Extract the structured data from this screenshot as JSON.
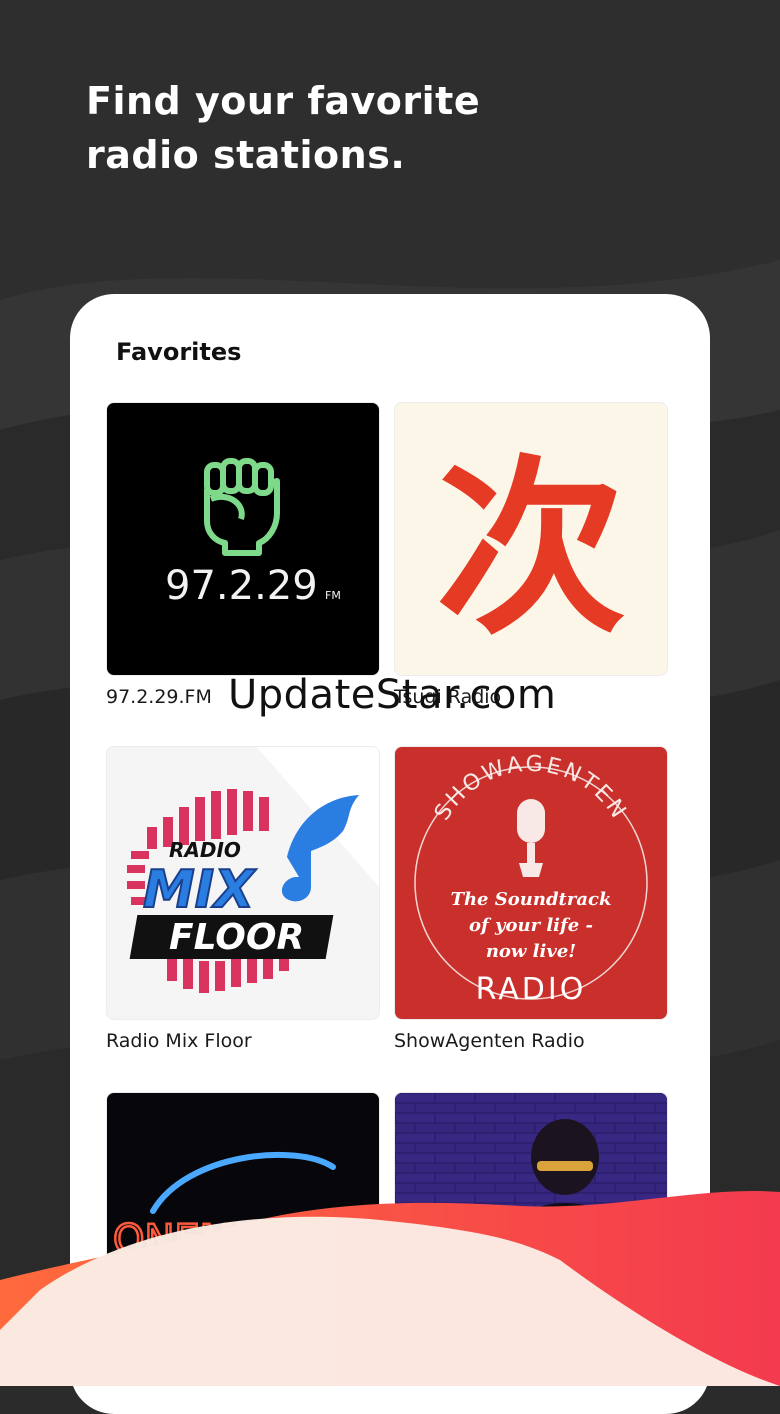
{
  "headline": {
    "line1": "Find your favorite",
    "line2": "radio stations."
  },
  "favorites": {
    "title": "Favorites",
    "stations": [
      {
        "name": "97.2.29.FM",
        "logo_text": "97.2.29",
        "logo_suffix": "FM",
        "logo_icon": "raised-fist-icon"
      },
      {
        "name": "Tsugi Radio",
        "logo_text": "次"
      },
      {
        "name": "Radio Mix Floor",
        "logo_top": "RADIO",
        "logo_mid": "MIX",
        "logo_bottom": "FLOOR"
      },
      {
        "name": "ShowAgenten Radio",
        "logo_arc": "SHOWAGENTEN",
        "logo_tagline_1": "The Soundtrack",
        "logo_tagline_2": "of your life -",
        "logo_tagline_3": "now live!",
        "logo_bottom": "RADIO"
      },
      {
        "name": "",
        "logo_text": "ONEMUSIC"
      },
      {
        "name": ""
      }
    ]
  },
  "watermark": "UpdateStar.com",
  "colors": {
    "background": "#2b2b2b",
    "accent_wave_start": "#ff6a3d",
    "accent_wave_end": "#f33a4e",
    "tsugi_red": "#e53a23",
    "showagenten_red": "#c9302c",
    "fist_green": "#7ed98a"
  }
}
